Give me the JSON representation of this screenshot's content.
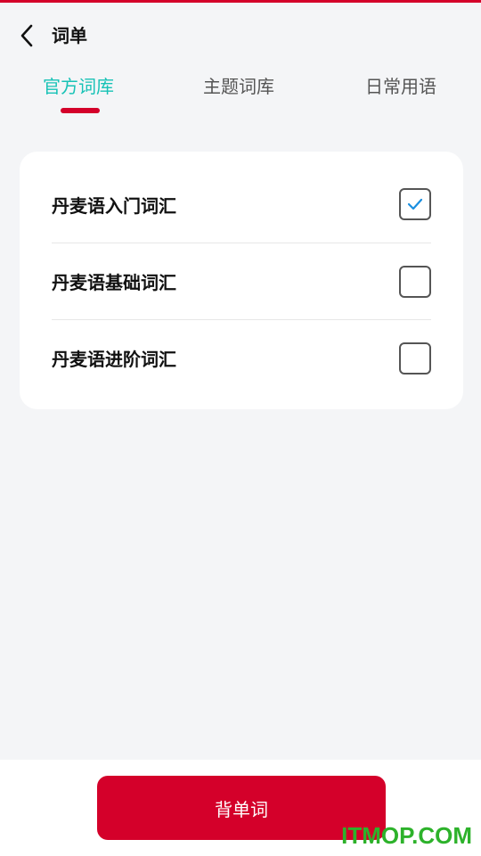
{
  "header": {
    "title": "词单",
    "back_icon": "chevron-left-icon"
  },
  "tabs": [
    {
      "label": "官方词库",
      "active": true
    },
    {
      "label": "主题词库",
      "active": false
    },
    {
      "label": "日常用语",
      "active": false
    }
  ],
  "word_lists": [
    {
      "label": "丹麦语入门词汇",
      "checked": true
    },
    {
      "label": "丹麦语基础词汇",
      "checked": false
    },
    {
      "label": "丹麦语进阶词汇",
      "checked": false
    }
  ],
  "bottom": {
    "primary_button": "背单词"
  },
  "watermark": "ITMOP.COM",
  "colors": {
    "accent_red": "#d4002a",
    "active_tab_teal": "#17c2b6",
    "check_blue": "#1a8fe0",
    "background": "#f4f5f7"
  }
}
